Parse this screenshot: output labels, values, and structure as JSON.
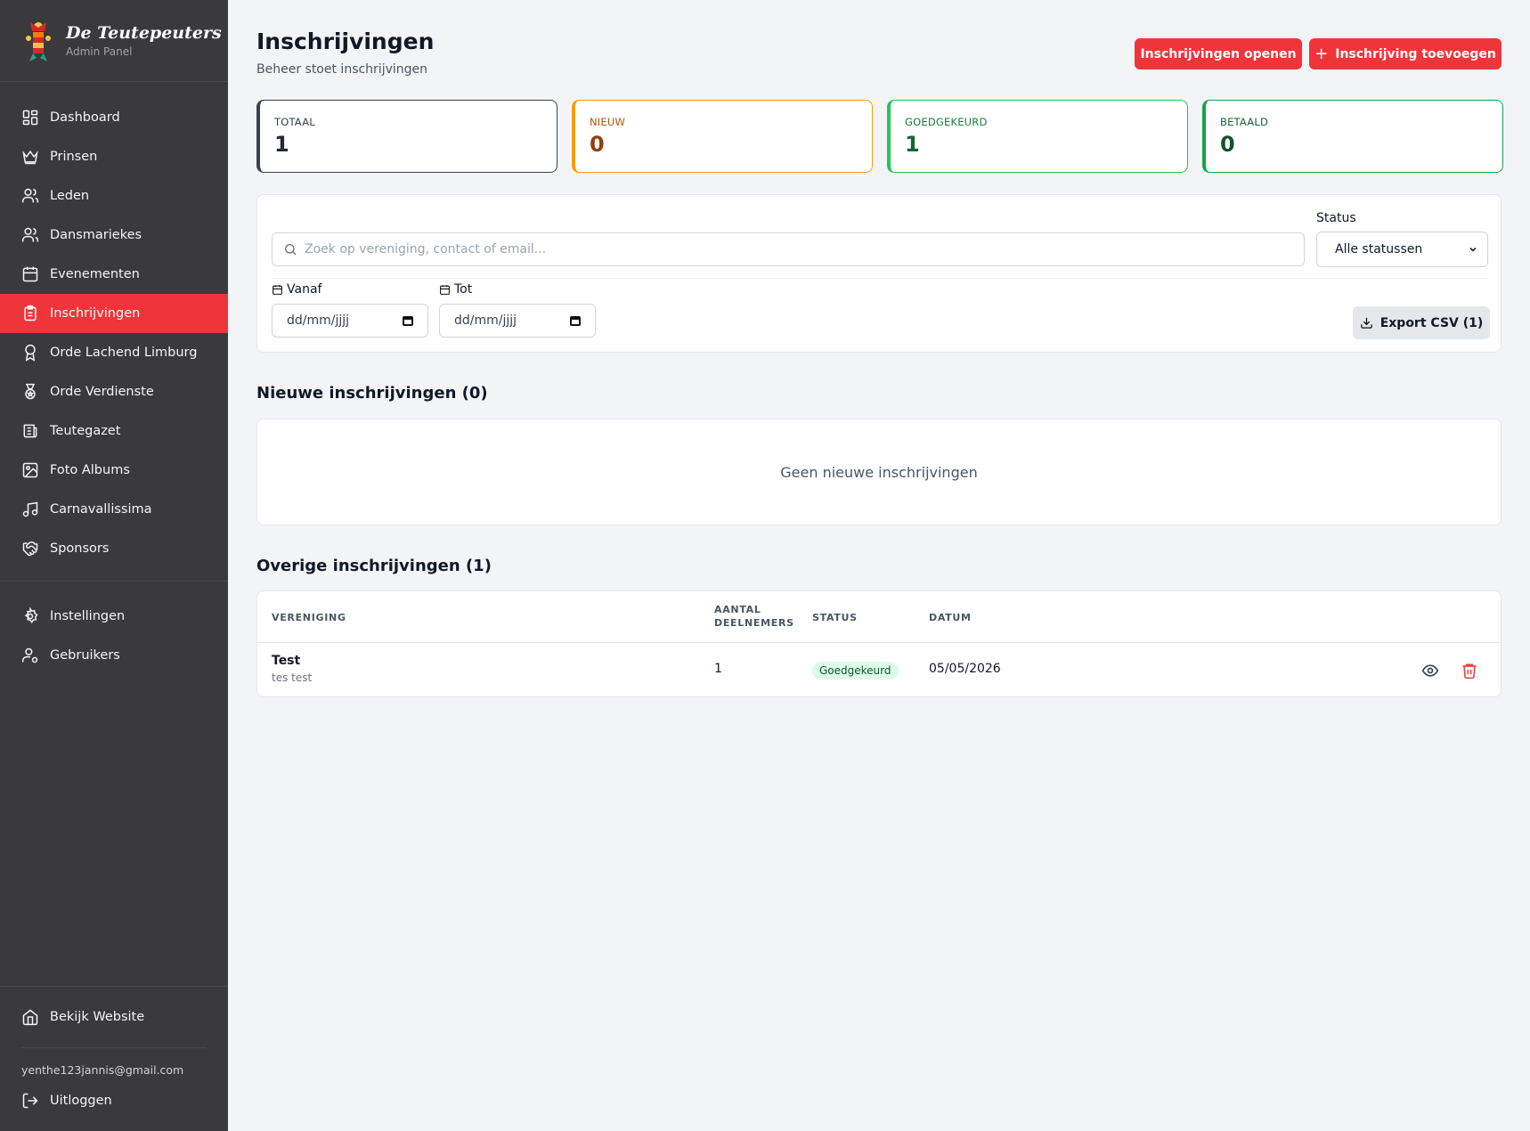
{
  "brand": {
    "name": "De Teutepeuters",
    "subtitle": "Admin Panel"
  },
  "sidebar": {
    "items": [
      {
        "label": "Dashboard",
        "icon": "dashboard-icon",
        "active": false
      },
      {
        "label": "Prinsen",
        "icon": "crown-icon",
        "active": false
      },
      {
        "label": "Leden",
        "icon": "users-icon",
        "active": false
      },
      {
        "label": "Dansmariekes",
        "icon": "users-icon",
        "active": false
      },
      {
        "label": "Evenementen",
        "icon": "calendar-icon",
        "active": false
      },
      {
        "label": "Inschrijvingen",
        "icon": "clipboard-icon",
        "active": true
      },
      {
        "label": "Orde Lachend Limburg",
        "icon": "award-icon",
        "active": false
      },
      {
        "label": "Orde Verdienste",
        "icon": "medal-icon",
        "active": false
      },
      {
        "label": "Teutegazet",
        "icon": "newspaper-icon",
        "active": false
      },
      {
        "label": "Foto Albums",
        "icon": "image-icon",
        "active": false
      },
      {
        "label": "Carnavallissima",
        "icon": "music-icon",
        "active": false
      },
      {
        "label": "Sponsors",
        "icon": "handshake-icon",
        "active": false
      }
    ],
    "secondary": [
      {
        "label": "Instellingen",
        "icon": "gear-icon"
      },
      {
        "label": "Gebruikers",
        "icon": "user-cog-icon"
      }
    ],
    "website": {
      "label": "Bekijk Website",
      "icon": "home-icon"
    },
    "user_email": "yenthe123jannis@gmail.com",
    "logout": {
      "label": "Uitloggen",
      "icon": "logout-icon"
    }
  },
  "header": {
    "title": "Inschrijvingen",
    "subtitle": "Beheer stoet inschrijvingen",
    "open_button": "Inschrijvingen openen",
    "add_button": "Inschrijving toevoegen"
  },
  "stats": {
    "total": {
      "label": "TOTAAL",
      "value": "1"
    },
    "new": {
      "label": "NIEUW",
      "value": "0"
    },
    "approved": {
      "label": "GOEDGEKEURD",
      "value": "1"
    },
    "paid": {
      "label": "BETAALD",
      "value": "0"
    }
  },
  "filters": {
    "search_placeholder": "Zoek op vereniging, contact of email...",
    "status_label": "Status",
    "status_value": "Alle statussen",
    "from_label": "Vanaf",
    "to_label": "Tot",
    "date_placeholder": "dd/mm/jjjj",
    "export_label": "Export CSV (1)"
  },
  "new_section": {
    "title": "Nieuwe inschrijvingen (0)",
    "empty_text": "Geen nieuwe inschrijvingen"
  },
  "other_section": {
    "title": "Overige inschrijvingen (1)",
    "columns": {
      "vereniging": "VERENIGING",
      "aantal_1": "AANTAL",
      "aantal_2": "DEELNEMERS",
      "status": "STATUS",
      "datum": "DATUM"
    },
    "rows": [
      {
        "name": "Test",
        "contact": "tes test",
        "count": "1",
        "status": "Goedgekeurd",
        "date": "05/05/2026"
      }
    ]
  },
  "colors": {
    "accent": "#f0353a",
    "sidebar": "#3a3a3c",
    "background": "#f3f4f6"
  }
}
